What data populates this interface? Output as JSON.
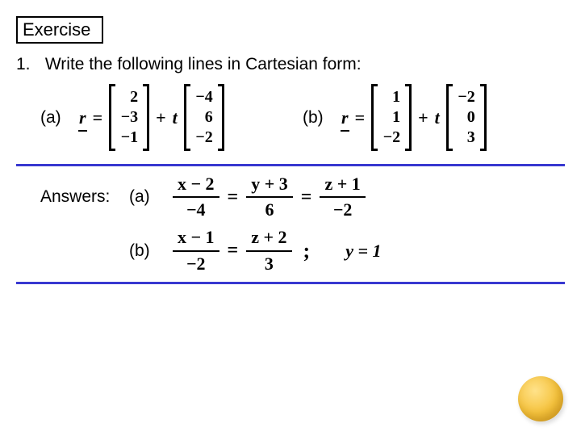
{
  "title": "Exercise",
  "question": {
    "number": "1.",
    "text": "Write the following lines in Cartesian form:"
  },
  "parts": {
    "a": {
      "label": "(a)",
      "rvar": "r",
      "eq": "=",
      "plus": "+",
      "t": "t",
      "vec1": [
        "2",
        "−3",
        "−1"
      ],
      "vec2": [
        "−4",
        "6",
        "−2"
      ]
    },
    "b": {
      "label": "(b)",
      "rvar": "r",
      "eq": "=",
      "plus": "+",
      "t": "t",
      "vec1": [
        "1",
        "1",
        "−2"
      ],
      "vec2": [
        "−2",
        "0",
        "3"
      ]
    }
  },
  "answers": {
    "heading": "Answers:",
    "a": {
      "label": "(a)",
      "f1": {
        "num": "x − 2",
        "den": "−4"
      },
      "f2": {
        "num": "y + 3",
        "den": "6"
      },
      "f3": {
        "num": "z + 1",
        "den": "−2"
      },
      "eq": "="
    },
    "b": {
      "label": "(b)",
      "f1": {
        "num": "x − 1",
        "den": "−2"
      },
      "f2": {
        "num": "z + 2",
        "den": "3"
      },
      "eq": "=",
      "semi": ";",
      "extra": "y = 1"
    }
  }
}
